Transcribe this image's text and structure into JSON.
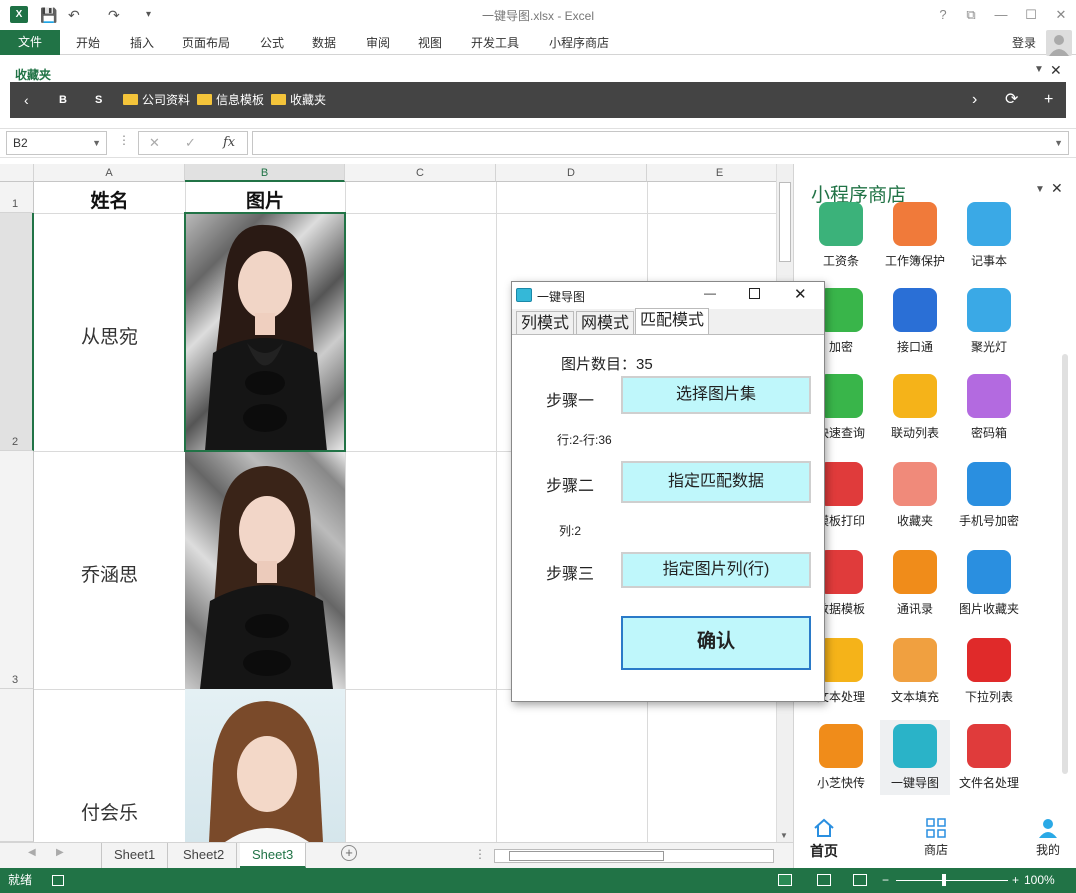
{
  "window": {
    "title": "一键导图.xlsx - Excel",
    "help": "?",
    "restore": "⧉",
    "minimize": "—",
    "maximize": "☐",
    "close": "✕"
  },
  "ribbon": {
    "file": "文件",
    "tabs": [
      "开始",
      "插入",
      "页面布局",
      "公式",
      "数据",
      "审阅",
      "视图",
      "开发工具",
      "小程序商店"
    ],
    "login": "登录"
  },
  "favorites": {
    "label": "收藏夹",
    "items": [
      "公司资料",
      "信息模板",
      "收藏夹"
    ],
    "btn_b": "B",
    "btn_s": "S"
  },
  "formula": {
    "namebox": "B2",
    "fx": "fx"
  },
  "grid": {
    "columns": [
      "A",
      "B",
      "C",
      "D",
      "E"
    ],
    "rows": [
      "1",
      "2",
      "3"
    ],
    "header": {
      "name": "姓名",
      "pic": "图片"
    },
    "names": [
      "从思宛",
      "乔涵思",
      "付会乐"
    ]
  },
  "sheets": {
    "tabs": [
      "Sheet1",
      "Sheet2",
      "Sheet3"
    ],
    "active": "Sheet3"
  },
  "status": {
    "ready": "就绪",
    "zoom": "100%"
  },
  "store": {
    "title": "小程序商店",
    "apps": [
      {
        "label": "工资条",
        "color": "#3bb27a"
      },
      {
        "label": "工作簿保护",
        "color": "#f07a3a"
      },
      {
        "label": "记事本",
        "color": "#3aa9e6"
      },
      {
        "label": "加密",
        "color": "#39b54a"
      },
      {
        "label": "接口通",
        "color": "#2a6fd6"
      },
      {
        "label": "聚光灯",
        "color": "#3aa9e6"
      },
      {
        "label": "快速查询",
        "color": "#39b54a"
      },
      {
        "label": "联动列表",
        "color": "#f5b319"
      },
      {
        "label": "密码箱",
        "color": "#b36ae0"
      },
      {
        "label": "模板打印",
        "color": "#e03b3b"
      },
      {
        "label": "收藏夹",
        "color": "#f08a7a"
      },
      {
        "label": "手机号加密",
        "color": "#2a8fe0"
      },
      {
        "label": "数据模板",
        "color": "#e03b3b"
      },
      {
        "label": "通讯录",
        "color": "#f08c1a"
      },
      {
        "label": "图片收藏夹",
        "color": "#2a8fe0"
      },
      {
        "label": "文本处理",
        "color": "#f5b319"
      },
      {
        "label": "文本填充",
        "color": "#f0a040"
      },
      {
        "label": "下拉列表",
        "color": "#e02a2a"
      },
      {
        "label": "小芝快传",
        "color": "#f08c1a"
      },
      {
        "label": "一键导图",
        "color": "#2ab3c8"
      },
      {
        "label": "文件名处理",
        "color": "#e03b3b"
      }
    ],
    "nav": [
      "首页",
      "商店",
      "我的"
    ]
  },
  "dialog": {
    "title": "一键导图",
    "tabs": [
      "列模式",
      "网模式",
      "匹配模式"
    ],
    "count_label": "图片数目：35",
    "step1": "步骤一",
    "step1_btn": "选择图片集",
    "step1_info": "行:2-行:36",
    "step2": "步骤二",
    "step2_btn": "指定匹配数据",
    "step2_info": "列:2",
    "step3": "步骤三",
    "step3_btn": "指定图片列(行)",
    "confirm": "确认"
  }
}
